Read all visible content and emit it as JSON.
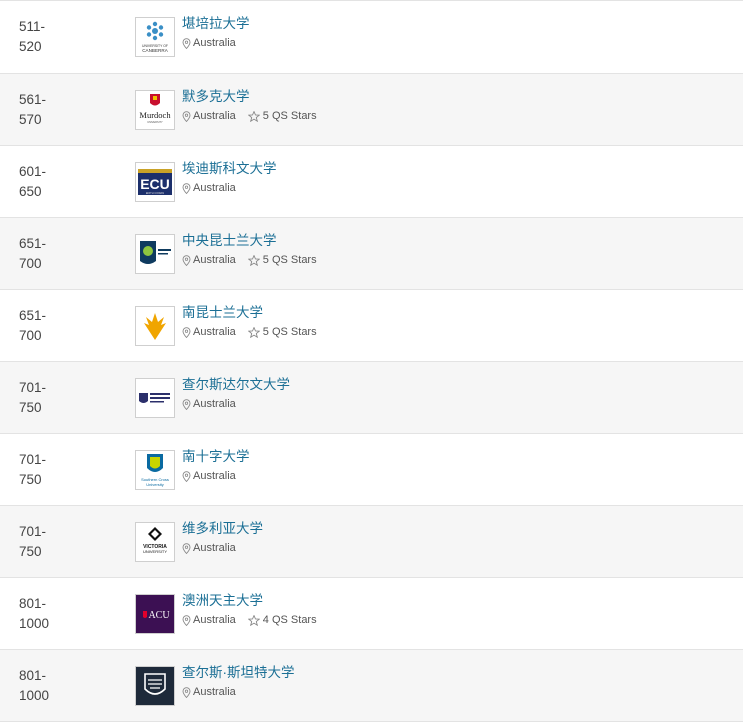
{
  "universities": [
    {
      "rank": "511-\n520",
      "name": "堪培拉大学",
      "location": "Australia",
      "stars": "",
      "logo": "canberra-logo",
      "logo_text": "UNIVERSITY OF CANBERRA"
    },
    {
      "rank": "561-\n570",
      "name": "默多克大学",
      "location": "Australia",
      "stars": "5 QS Stars",
      "logo": "murdoch-logo",
      "logo_text": "Murdoch"
    },
    {
      "rank": "601-\n650",
      "name": "埃迪斯科文大学",
      "location": "Australia",
      "stars": "",
      "logo": "ecu-logo",
      "logo_text": "ECU"
    },
    {
      "rank": "651-\n700",
      "name": "中央昆士兰大学",
      "location": "Australia",
      "stars": "5 QS Stars",
      "logo": "cqu-logo",
      "logo_text": ""
    },
    {
      "rank": "651-\n700",
      "name": "南昆士兰大学",
      "location": "Australia",
      "stars": "5 QS Stars",
      "logo": "usq-logo",
      "logo_text": ""
    },
    {
      "rank": "701-\n750",
      "name": "查尔斯达尔文大学",
      "location": "Australia",
      "stars": "",
      "logo": "cdu-logo",
      "logo_text": ""
    },
    {
      "rank": "701-\n750",
      "name": "南十字大学",
      "location": "Australia",
      "stars": "",
      "logo": "scu-logo",
      "logo_text": "Southern Cross University"
    },
    {
      "rank": "701-\n750",
      "name": "维多利亚大学",
      "location": "Australia",
      "stars": "",
      "logo": "vu-logo",
      "logo_text": "VICTORIA UNIVERSITY"
    },
    {
      "rank": "801-\n1000",
      "name": "澳洲天主大学",
      "location": "Australia",
      "stars": "4 QS Stars",
      "logo": "acu-logo",
      "logo_text": "ACU"
    },
    {
      "rank": "801-\n1000",
      "name": "查尔斯·斯坦特大学",
      "location": "Australia",
      "stars": "",
      "logo": "csu-logo",
      "logo_text": ""
    }
  ],
  "colors": {
    "link": "#1b6f95",
    "alt_row": "#f6f6f6",
    "border": "#e3e3e3"
  }
}
